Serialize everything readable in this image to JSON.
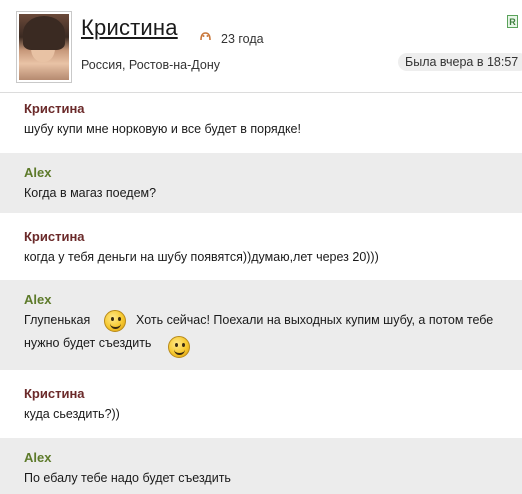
{
  "profile": {
    "name": "Кристина",
    "age": "23 года",
    "location": "Россия, Ростов-на-Дону",
    "last_seen": "Была вчера в 18:57",
    "online_badge": "R",
    "age_icon": "zodiac-icon",
    "avatar_icon": "user-photo"
  },
  "messages": [
    {
      "author": "Кристина",
      "lines": [
        "шубу купи мне норковую и все будет в порядке!"
      ]
    },
    {
      "author": "Alex",
      "lines": [
        "Когда в магаз поедем?"
      ]
    },
    {
      "author": "Кристина",
      "lines": [
        "когда у тебя деньги на шубу появятся))думаю,лет через 20)))"
      ]
    },
    {
      "author": "Alex",
      "lines": [
        "Глупенькая",
        "Хоть сейчас! Поехали на выходных купим шубу, а потом тебе",
        "нужно будет съездить"
      ]
    },
    {
      "author": "Кристина",
      "lines": [
        "куда сьездить?))"
      ]
    },
    {
      "author": "Alex",
      "lines": [
        "По ебалу тебе надо будет съездить"
      ]
    }
  ],
  "colors": {
    "kristina_name": "#6b2a2a",
    "alex_name": "#5d7a2a",
    "alt_row": "#ececec"
  }
}
